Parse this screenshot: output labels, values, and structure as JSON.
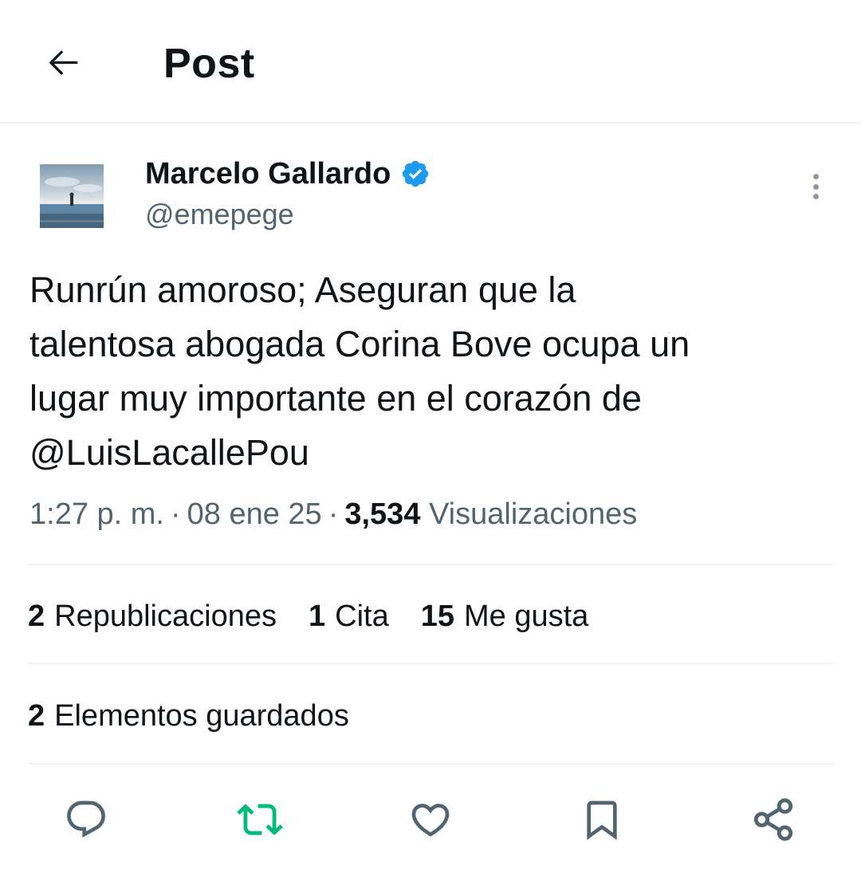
{
  "header": {
    "title": "Post",
    "back_icon": "arrow-left-icon"
  },
  "author": {
    "name": "Marcelo Gallardo",
    "handle": "@emepege",
    "verified": true,
    "verified_color": "#1d9bf0",
    "avatar_icon": "avatar-photo"
  },
  "post": {
    "lines": [
      "Runrún amoroso; Aseguran que la",
      "talentosa abogada Corina Bove ocupa un",
      "lugar muy importante en el corazón de",
      "@LuisLacallePou"
    ]
  },
  "meta": {
    "time": "1:27 p. m.",
    "separator": "·",
    "date": "08 ene 25",
    "views_count": "3,534",
    "views_label": "Visualizaciones"
  },
  "stats": {
    "reposts_count": "2",
    "reposts_label": "Republicaciones",
    "quotes_count": "1",
    "quotes_label": "Cita",
    "likes_count": "15",
    "likes_label": "Me gusta"
  },
  "saved": {
    "count": "2",
    "label": "Elementos guardados"
  },
  "actions": {
    "reply_icon": "reply-icon",
    "repost_icon": "repost-icon",
    "repost_color": "#00ba7c",
    "like_icon": "heart-icon",
    "bookmark_icon": "bookmark-icon",
    "share_icon": "share-icon",
    "icon_color": "#536471"
  }
}
